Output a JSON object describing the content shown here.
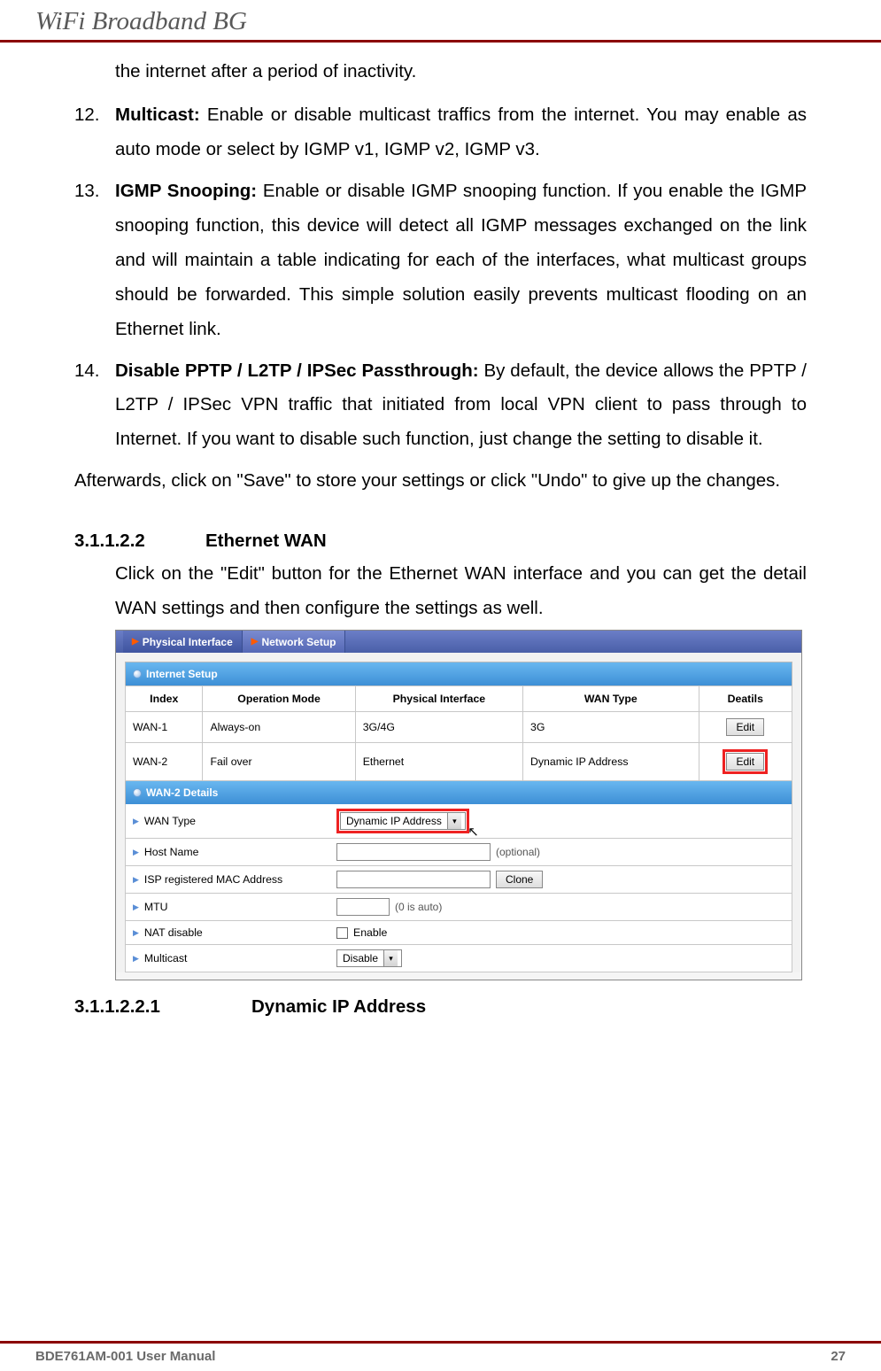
{
  "header": {
    "title": "WiFi Broadband BG"
  },
  "list": {
    "continuation": "the internet after a period of inactivity.",
    "items": [
      {
        "num": "12.",
        "bold": "Multicast:",
        "text": " Enable or disable multicast traffics from the internet. You may enable as auto mode or select by IGMP v1, IGMP v2, IGMP v3."
      },
      {
        "num": "13.",
        "bold": "IGMP Snooping:",
        "text": " Enable or disable IGMP snooping function. If you enable the IGMP snooping function, this device will detect all IGMP messages exchanged on the link and will maintain a table indicating for each of the interfaces, what multicast groups should be forwarded. This simple solution easily prevents multicast flooding on an Ethernet link."
      },
      {
        "num": "14.",
        "bold": "Disable PPTP / L2TP / IPSec Passthrough:",
        "text": " By default, the device allows the PPTP / L2TP / IPSec VPN traffic that initiated from local VPN client to pass through to Internet. If you want to disable such function, just change the setting to disable it."
      }
    ],
    "afterwards": "Afterwards, click on \"Save\" to store your settings or click \"Undo\" to give up the changes."
  },
  "section": {
    "num": "3.1.1.2.2",
    "title": "Ethernet WAN",
    "intro": "Click on the \"Edit\" button for the Ethernet WAN interface and you can get the detail WAN settings and then configure the settings as well."
  },
  "ui": {
    "tabs": {
      "physical": "Physical Interface",
      "network": "Network Setup"
    },
    "panelTitle": "Internet Setup",
    "cols": {
      "index": "Index",
      "mode": "Operation Mode",
      "phys": "Physical Interface",
      "wtype": "WAN Type",
      "details": "Deatils"
    },
    "rows": [
      {
        "index": "WAN-1",
        "mode": "Always-on",
        "phys": "3G/4G",
        "wtype": "3G",
        "edit": "Edit"
      },
      {
        "index": "WAN-2",
        "mode": "Fail over",
        "phys": "Ethernet",
        "wtype": "Dynamic IP Address",
        "edit": "Edit"
      }
    ],
    "detailsTitle": "WAN-2 Details",
    "details": {
      "wantype": {
        "label": "WAN Type",
        "value": "Dynamic IP Address"
      },
      "hostname": {
        "label": "Host Name",
        "note": "(optional)"
      },
      "ispmac": {
        "label": "ISP registered MAC Address",
        "btn": "Clone"
      },
      "mtu": {
        "label": "MTU",
        "note": "(0 is auto)"
      },
      "nat": {
        "label": "NAT disable",
        "opt": "Enable"
      },
      "multicast": {
        "label": "Multicast",
        "value": "Disable"
      }
    }
  },
  "subsection": {
    "num": "3.1.1.2.2.1",
    "title": "Dynamic IP Address"
  },
  "footer": {
    "left": "BDE761AM-001   User Manual",
    "right": "27"
  }
}
